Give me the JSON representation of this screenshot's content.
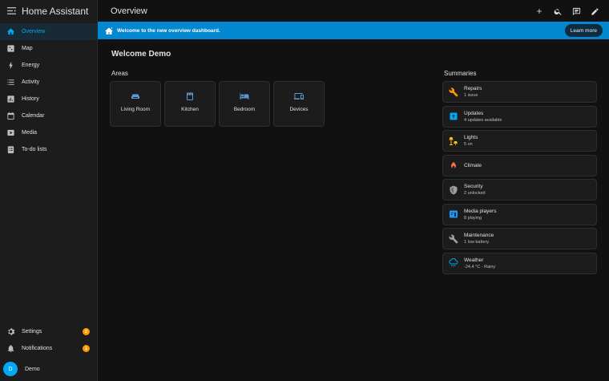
{
  "app": {
    "title": "Home Assistant"
  },
  "topbar": {
    "title": "Overview"
  },
  "banner": {
    "text": "Welcome to the new overview dashboard.",
    "button_label": "Learn more"
  },
  "sidebar": {
    "items": [
      {
        "label": "Overview",
        "icon": "home-icon",
        "active": true
      },
      {
        "label": "Map",
        "icon": "map-icon"
      },
      {
        "label": "Energy",
        "icon": "lightning-icon"
      },
      {
        "label": "Activity",
        "icon": "list-icon"
      },
      {
        "label": "History",
        "icon": "chart-box-icon"
      },
      {
        "label": "Calendar",
        "icon": "calendar-icon"
      },
      {
        "label": "Media",
        "icon": "media-icon"
      },
      {
        "label": "To-do lists",
        "icon": "clipboard-list-icon"
      }
    ],
    "bottom": [
      {
        "label": "Settings",
        "icon": "gear-icon",
        "badge": "2"
      },
      {
        "label": "Notifications",
        "icon": "bell-icon",
        "badge": "1"
      }
    ],
    "user": {
      "initial": "D",
      "name": "Demo"
    }
  },
  "main": {
    "welcome": "Welcome Demo",
    "areas_heading": "Areas",
    "areas": [
      {
        "label": "Living Room",
        "icon": "sofa-icon"
      },
      {
        "label": "Kitchen",
        "icon": "stove-icon"
      },
      {
        "label": "Bedroom",
        "icon": "bed-icon"
      },
      {
        "label": "Devices",
        "icon": "devices-icon"
      }
    ],
    "summaries_heading": "Summaries",
    "summaries": [
      {
        "name": "Repairs",
        "desc": "1 issue",
        "icon": "wrench-icon",
        "color": "#ff9800"
      },
      {
        "name": "Updates",
        "desc": "4 updates available",
        "icon": "update-icon",
        "color": "#03a9f4"
      },
      {
        "name": "Lights",
        "desc": "5 on",
        "icon": "lamps-icon",
        "color": "#ffc107"
      },
      {
        "name": "Climate",
        "desc": "",
        "icon": "thermostat-icon",
        "color": "#ff7043"
      },
      {
        "name": "Security",
        "desc": "2 unlocked",
        "icon": "shield-icon",
        "color": "#9e9e9e"
      },
      {
        "name": "Media players",
        "desc": "8 playing",
        "icon": "media-players-icon",
        "color": "#2196f3"
      },
      {
        "name": "Maintenance",
        "desc": "1 low battery",
        "icon": "wrench-gray-icon",
        "color": "#9e9e9e"
      },
      {
        "name": "Weather",
        "desc": "-24.4 °C · Rainy",
        "icon": "weather-rainy-icon",
        "color": "#03a9f4"
      }
    ]
  },
  "colors": {
    "accent": "#03a9f4",
    "banner": "#0288d1",
    "badge": "#ff9800"
  }
}
